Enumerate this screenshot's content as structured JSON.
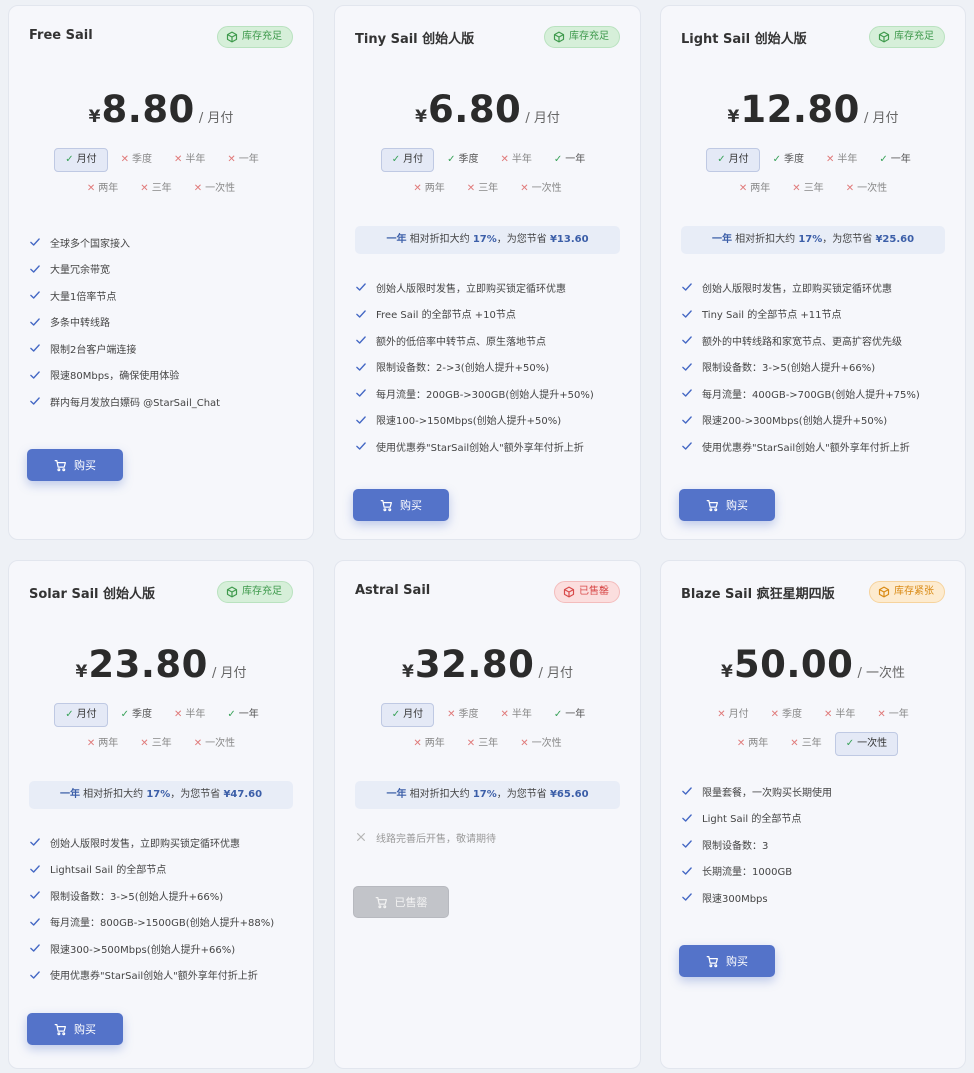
{
  "labels": {
    "per_month": "/ 月付",
    "per_once": "/ 一次性",
    "currency": "¥",
    "saving_pre": "一年",
    "saving_mid": "相对折扣大约",
    "saving_pct": "17%",
    "saving_post": "，为您节省",
    "buy": "购买",
    "sold_button": "已售罄"
  },
  "colors": {
    "accent": "#5473c9",
    "in_stock": "#3f9a4d",
    "sold_out": "#d84b4b",
    "low_stock": "#d98a14"
  },
  "plans": [
    {
      "title": "Free Sail",
      "badge": "库存充足",
      "badge_type": "ok",
      "price": "8.80",
      "per": "/ 月付",
      "periods": [
        {
          "label": "月付",
          "state": "sel"
        },
        {
          "label": "季度",
          "state": "na"
        },
        {
          "label": "半年",
          "state": "na"
        },
        {
          "label": "一年",
          "state": "na"
        },
        {
          "label": "两年",
          "state": "na"
        },
        {
          "label": "三年",
          "state": "na"
        },
        {
          "label": "一次性",
          "state": "na"
        }
      ],
      "saving": null,
      "features": [
        "全球多个国家接入",
        "大量冗余带宽",
        "大量1倍率节点",
        "多条中转线路",
        "限制2台客户端连接",
        "限速80Mbps，确保使用体验",
        "群内每月发放白嫖码 @StarSail_Chat"
      ],
      "button": "购买",
      "button_state": "buy"
    },
    {
      "title": "Tiny Sail 创始人版",
      "badge": "库存充足",
      "badge_type": "ok",
      "price": "6.80",
      "per": "/ 月付",
      "periods": [
        {
          "label": "月付",
          "state": "sel"
        },
        {
          "label": "季度",
          "state": "ok"
        },
        {
          "label": "半年",
          "state": "na"
        },
        {
          "label": "一年",
          "state": "ok"
        },
        {
          "label": "两年",
          "state": "na"
        },
        {
          "label": "三年",
          "state": "na"
        },
        {
          "label": "一次性",
          "state": "na"
        }
      ],
      "saving": "¥13.60",
      "features": [
        "创始人版限时发售，立即购买锁定循环优惠",
        "Free Sail 的全部节点 +10节点",
        "额外的低倍率中转节点、原生落地节点",
        "限制设备数：2->3(创始人提升+50%)",
        "每月流量：200GB->300GB(创始人提升+50%)",
        "限速100->150Mbps(创始人提升+50%)",
        "使用优惠券\"StarSail创始人\"额外享年付折上折"
      ],
      "button": "购买",
      "button_state": "buy"
    },
    {
      "title": "Light Sail 创始人版",
      "badge": "库存充足",
      "badge_type": "ok",
      "price": "12.80",
      "per": "/ 月付",
      "periods": [
        {
          "label": "月付",
          "state": "sel"
        },
        {
          "label": "季度",
          "state": "ok"
        },
        {
          "label": "半年",
          "state": "na"
        },
        {
          "label": "一年",
          "state": "ok"
        },
        {
          "label": "两年",
          "state": "na"
        },
        {
          "label": "三年",
          "state": "na"
        },
        {
          "label": "一次性",
          "state": "na"
        }
      ],
      "saving": "¥25.60",
      "features": [
        "创始人版限时发售，立即购买锁定循环优惠",
        "Tiny Sail 的全部节点 +11节点",
        "额外的中转线路和家宽节点、更高扩容优先级",
        "限制设备数：3->5(创始人提升+66%)",
        "每月流量：400GB->700GB(创始人提升+75%)",
        "限速200->300Mbps(创始人提升+50%)",
        "使用优惠券\"StarSail创始人\"额外享年付折上折"
      ],
      "button": "购买",
      "button_state": "buy"
    },
    {
      "title": "Solar Sail 创始人版",
      "badge": "库存充足",
      "badge_type": "ok",
      "price": "23.80",
      "per": "/ 月付",
      "periods": [
        {
          "label": "月付",
          "state": "sel"
        },
        {
          "label": "季度",
          "state": "ok"
        },
        {
          "label": "半年",
          "state": "na"
        },
        {
          "label": "一年",
          "state": "ok"
        },
        {
          "label": "两年",
          "state": "na"
        },
        {
          "label": "三年",
          "state": "na"
        },
        {
          "label": "一次性",
          "state": "na"
        }
      ],
      "saving": "¥47.60",
      "features": [
        "创始人版限时发售，立即购买锁定循环优惠",
        "Lightsail Sail 的全部节点",
        "限制设备数：3->5(创始人提升+66%)",
        "每月流量：800GB->1500GB(创始人提升+88%)",
        "限速300->500Mbps(创始人提升+66%)",
        "使用优惠券\"StarSail创始人\"额外享年付折上折"
      ],
      "button": "购买",
      "button_state": "buy"
    },
    {
      "title": "Astral Sail",
      "badge": "已售罄",
      "badge_type": "sold",
      "price": "32.80",
      "per": "/ 月付",
      "periods": [
        {
          "label": "月付",
          "state": "sel"
        },
        {
          "label": "季度",
          "state": "na"
        },
        {
          "label": "半年",
          "state": "na"
        },
        {
          "label": "一年",
          "state": "ok"
        },
        {
          "label": "两年",
          "state": "na"
        },
        {
          "label": "三年",
          "state": "na"
        },
        {
          "label": "一次性",
          "state": "na"
        }
      ],
      "saving": "¥65.60",
      "features": [
        "线路完善后开售，敬请期待"
      ],
      "features_muted": true,
      "button": "已售罄",
      "button_state": "sold"
    },
    {
      "title": "Blaze Sail 疯狂星期四版",
      "badge": "库存紧张",
      "badge_type": "low",
      "price": "50.00",
      "per": "/ 一次性",
      "periods": [
        {
          "label": "月付",
          "state": "na"
        },
        {
          "label": "季度",
          "state": "na"
        },
        {
          "label": "半年",
          "state": "na"
        },
        {
          "label": "一年",
          "state": "na"
        },
        {
          "label": "两年",
          "state": "na"
        },
        {
          "label": "三年",
          "state": "na"
        },
        {
          "label": "一次性",
          "state": "sel"
        }
      ],
      "saving": null,
      "features": [
        "限量套餐，一次购买长期使用",
        "Light Sail 的全部节点",
        "限制设备数：3",
        "长期流量：1000GB",
        "限速300Mbps"
      ],
      "button": "购买",
      "button_state": "buy"
    }
  ]
}
